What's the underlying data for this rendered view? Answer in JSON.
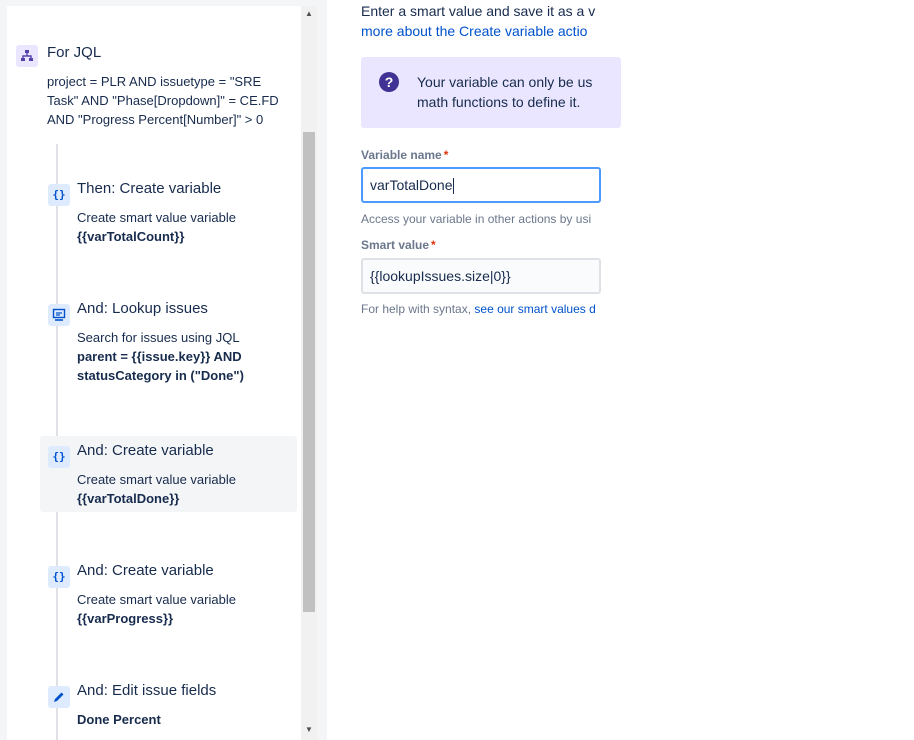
{
  "jql_step": {
    "title": "For JQL",
    "icon": "branch-icon",
    "query_line1": "project = PLR AND issuetype = \"SRE",
    "query_line2": "Task\" AND \"Phase[Dropdown]\" = CE.FD",
    "query_line3": "AND \"Progress Percent[Number]\" > 0"
  },
  "steps": [
    {
      "title": "Then: Create variable",
      "icon": "braces-icon",
      "desc": "Create smart value variable",
      "bold": "{{varTotalCount}}"
    },
    {
      "title": "And: Lookup issues",
      "icon": "lookup-icon",
      "desc": "Search for issues using JQL",
      "bold1": "parent = {{issue.key}} AND",
      "bold2": "statusCategory in (\"Done\")"
    },
    {
      "title": "And: Create variable",
      "icon": "braces-icon",
      "desc": "Create smart value variable",
      "bold": "{{varTotalDone}}",
      "highlighted": true
    },
    {
      "title": "And: Create variable",
      "icon": "braces-icon",
      "desc": "Create smart value variable",
      "bold": "{{varProgress}}"
    },
    {
      "title": "And: Edit issue fields",
      "icon": "pencil-icon",
      "bold": "Done Percent"
    }
  ],
  "form": {
    "intro_line1": "Enter a smart value and save it as a v",
    "intro_line2": "more about the Create variable actio",
    "info_line1": "Your variable can only be us",
    "info_line2": "math functions to define it.",
    "variable_name_label": "Variable name",
    "required_mark": "*",
    "variable_name_value": "varTotalDone",
    "variable_help": "Access your variable in other actions by usi",
    "smart_value_label": "Smart value",
    "smart_value_value": "{{lookupIssues.size|0}}",
    "syntax_help_prefix": "For help with syntax, ",
    "syntax_help_link": "see our smart values d"
  },
  "scroll": {
    "up_arrow": "▲",
    "down_arrow": "▼"
  },
  "colors": {
    "accent": "#0052cc",
    "focus_border": "#4c9aff",
    "info_bg": "#eae6ff",
    "required": "#de350b"
  }
}
